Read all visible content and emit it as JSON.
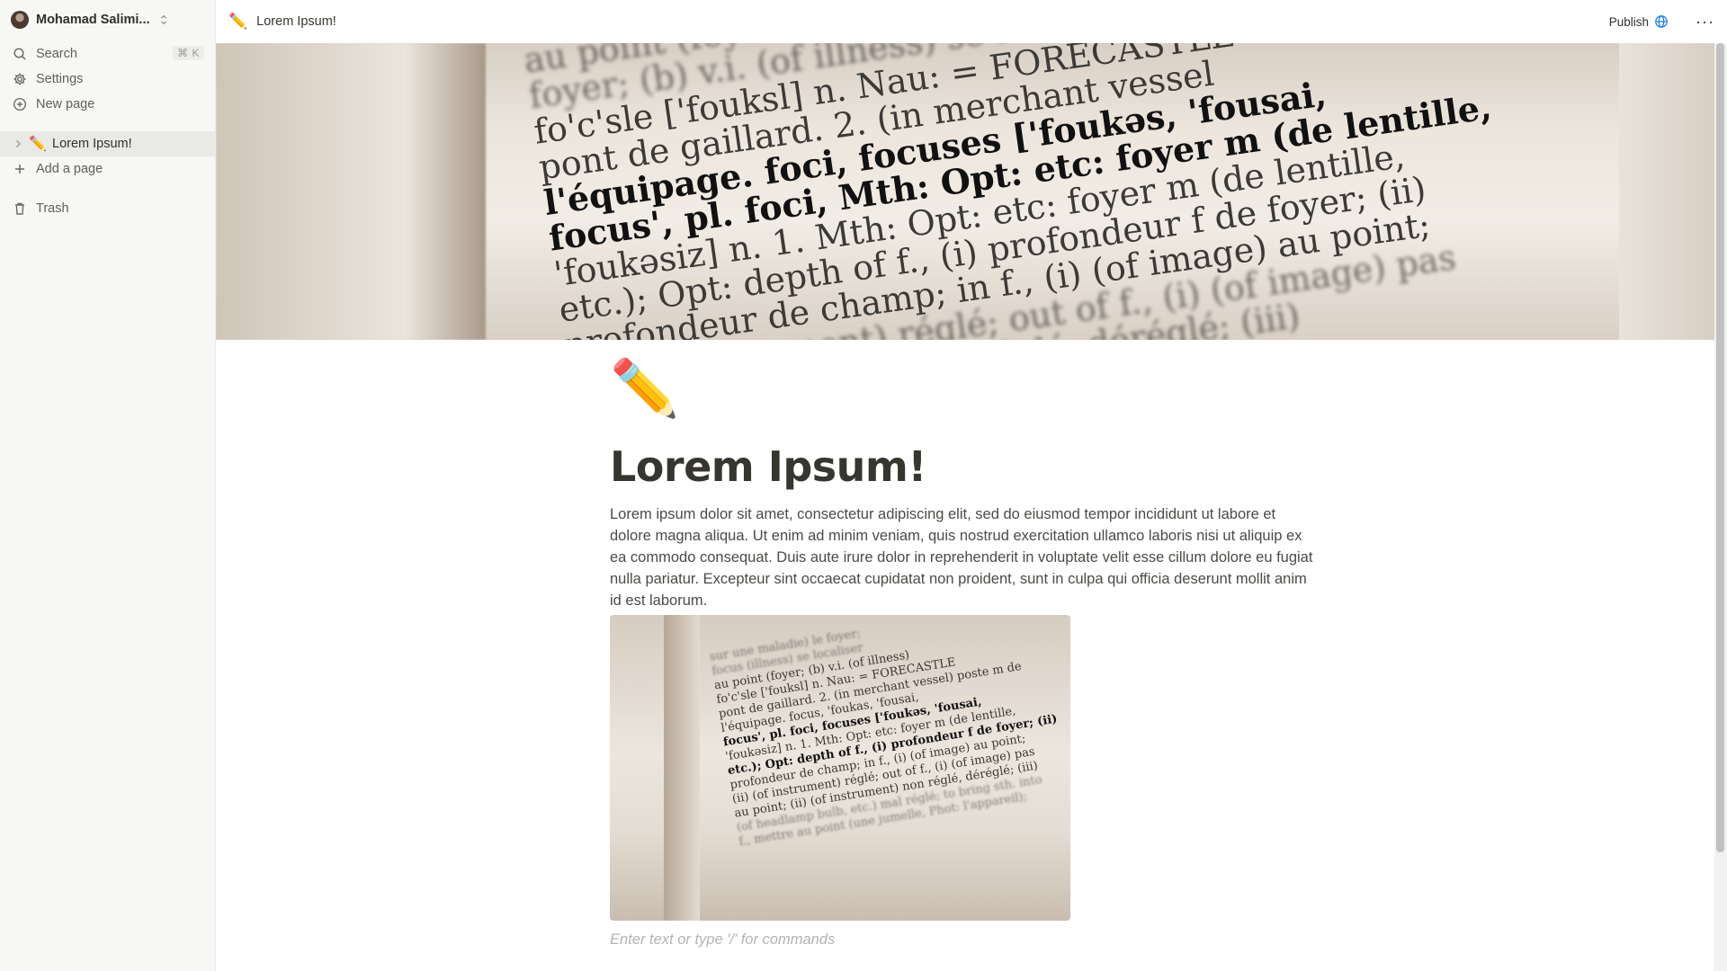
{
  "workspace": {
    "name": "Mohamad Salimi..."
  },
  "nav": {
    "search_label": "Search",
    "search_shortcut": "⌘ K",
    "settings_label": "Settings",
    "new_page_label": "New page"
  },
  "pages": [
    {
      "emoji": "✏️",
      "title": "Lorem Ipsum!"
    }
  ],
  "add_page_label": "Add a page",
  "trash_label": "Trash",
  "topbar": {
    "breadcrumb_emoji": "✏️",
    "breadcrumb_title": "Lorem Ipsum!",
    "publish_label": "Publish",
    "more_label": "···"
  },
  "cover": {
    "lines": [
      "au point (foyer; (b) v.i. (of illness",
      "foyer; (b) v.i. (of illness) se localiser",
      "fo'c'sle ['fouksl] n. Nau: = FORECASTLE",
      "pont de gaillard. 2. (in merchant vessel",
      "l'équipage. foci, focuses ['foukəs, 'fousai,",
      "focus', pl. foci, Mth: Opt: etc: foyer m (de lentille,",
      "'foukəsiz] n. 1. Mth: Opt: etc: foyer m (de lentille,",
      "etc.); Opt: depth of f., (i) profondeur f de foyer; (ii)",
      "profondeur de champ; in f., (i) (of image) au point;",
      "(ii) (of instrument) réglé; out of f., (i) (of image) pas",
      "(ii) (of instrument) non réglé, déréglé; (iii)"
    ]
  },
  "document": {
    "icon": "✏️",
    "title": "Lorem Ipsum!",
    "body": "Lorem ipsum dolor sit amet, consectetur adipiscing elit, sed do eiusmod tempor incididunt ut labore et dolore magna aliqua. Ut enim ad minim veniam, quis nostrud exercitation ullamco laboris nisi ut aliquip ex ea commodo consequat. Duis aute irure dolor in reprehenderit in voluptate velit esse cillum dolore eu fugiat nulla pariatur. Excepteur sint occaecat cupidatat non proident, sunt in culpa qui officia deserunt mollit anim id est laborum.",
    "image_lines": [
      "sur une maladie) le foyer;",
      "focus (illness) se localiser",
      "au point (foyer; (b) v.i. (of illness)",
      "fo'c'sle ['fouksl] n. Nau: = FORECASTLE",
      "pont de gaillard. 2. (in merchant vessel) poste m de",
      "l'équipage. focus, 'foukas, 'fousai,",
      "focus', pl. foci, focuses ['foukəs, 'fousai,",
      "'foukəsiz] n. 1. Mth: Opt: etc: foyer m (de lentille,",
      "etc.); Opt: depth of f., (i) profondeur f de foyer; (ii)",
      "profondeur de champ; in f., (i) (of image) au point;",
      "(ii) (of instrument) réglé; out of f., (i) (of image) pas",
      "au point; (ii) (of instrument) non réglé, déréglé; (iii)",
      "(of headlamp bulb, etc.) mal réglé; to bring sth. into",
      "f., mettre au point (une jumelle, Phot: l'appareil);"
    ],
    "placeholder": "Enter text or type '/' for commands"
  }
}
